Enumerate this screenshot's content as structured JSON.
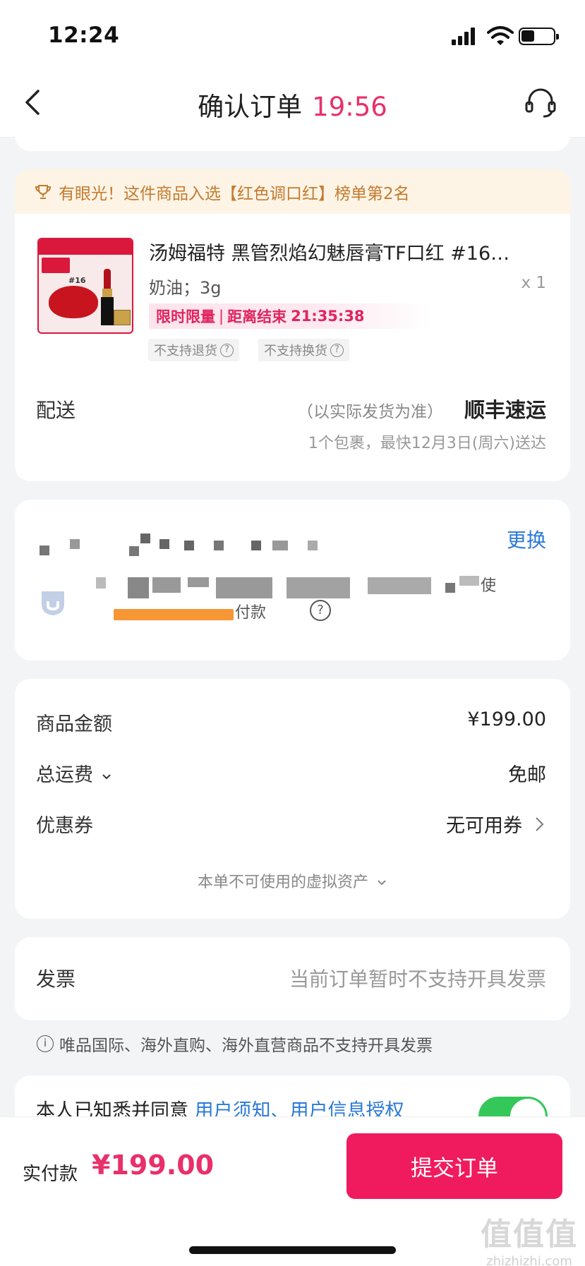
{
  "status_bar": {
    "time": "12:24"
  },
  "nav": {
    "title": "确认订单",
    "countdown": "19:56"
  },
  "product": {
    "rank_banner": "有眼光！这件商品入选【红色调口红】榜单第2名",
    "image_caption": "#16",
    "title": "汤姆福特 黑管烈焰幻魅唇膏TF口红 #16…",
    "spec": "奶油；3g",
    "quantity": "x 1",
    "promo_label": "限时限量",
    "promo_countdown_label": "距离结束",
    "promo_countdown": "21:35:38",
    "tags": [
      "不支持退货",
      "不支持换货"
    ],
    "shipping_label": "配送",
    "shipping_note": "（以实际发货为准）",
    "shipping_method": "顺丰速运",
    "shipping_eta": "1个包裹，最快12月3日(周六)送达"
  },
  "address": {
    "change_label": "更换",
    "payment_fragment": "付款",
    "trailing_fragment": "使"
  },
  "pricing": {
    "goods_amount_label": "商品金额",
    "goods_amount_value": "¥199.00",
    "shipping_fee_label": "总运费",
    "shipping_fee_value": "免邮",
    "coupon_label": "优惠券",
    "coupon_value": "无可用券",
    "virtual_assets": "本单不可使用的虚拟资产"
  },
  "invoice": {
    "label": "发票",
    "value": "当前订单暂时不支持开具发票",
    "note": "唯品国际、海外直购、海外直营商品不支持开具发票"
  },
  "agreement": {
    "prefix": "本人已知悉并同意",
    "links": "用户须知、用户信息授权",
    "toggle_on": true
  },
  "bottom": {
    "pay_label": "实付款",
    "pay_amount": "¥199.00",
    "submit_label": "提交订单"
  },
  "watermark": {
    "main": "值值值",
    "sub": "zhizhizhi.com"
  },
  "colors": {
    "accent": "#f01b5e",
    "link": "#2b79d6",
    "banner": "#fdf4e5",
    "toggle": "#34c759"
  }
}
